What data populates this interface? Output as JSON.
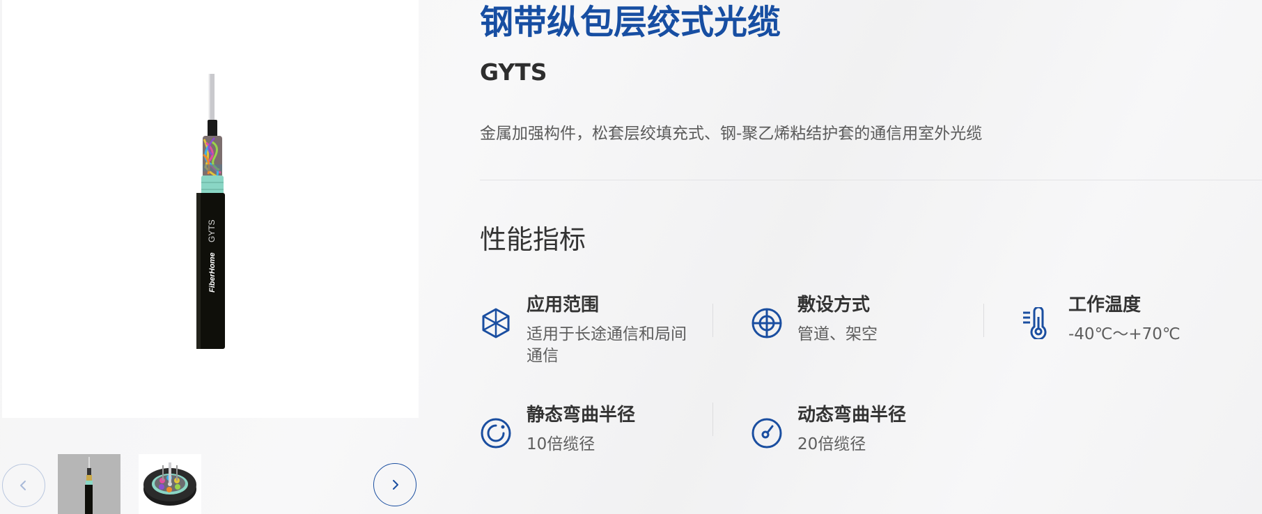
{
  "product": {
    "title": "钢带纵包层绞式光缆",
    "model": "GYTS",
    "description": "金属加强构件，松套层绞填充式、钢-聚乙烯粘结护套的通信用室外光缆"
  },
  "gallery": {
    "main_image_alt": "GYTS cable product image",
    "cable_print": "GYTS",
    "cable_brand": "FiberHome",
    "prev_icon": "chevron-left-icon",
    "next_icon": "chevron-right-icon",
    "thumbnails": [
      {
        "alt": "cable side view thumbnail"
      },
      {
        "alt": "cable cross-section thumbnail"
      }
    ]
  },
  "performance": {
    "section_title": "性能指标",
    "items": [
      {
        "title": "应用范围",
        "value": "适用于长途通信和局间通信",
        "icon": "cube-icon"
      },
      {
        "title": "敷设方式",
        "value": "管道、架空",
        "icon": "crosshair-icon"
      },
      {
        "title": "工作温度",
        "value": "-40℃～+70℃",
        "icon": "thermometer-icon"
      },
      {
        "title": "静态弯曲半径",
        "value": "10倍缆径",
        "icon": "static-bend-icon"
      },
      {
        "title": "动态弯曲半径",
        "value": "20倍缆径",
        "icon": "dynamic-bend-icon"
      }
    ]
  },
  "colors": {
    "brand_blue": "#174ea2",
    "icon_blue": "#1a4ea0"
  }
}
